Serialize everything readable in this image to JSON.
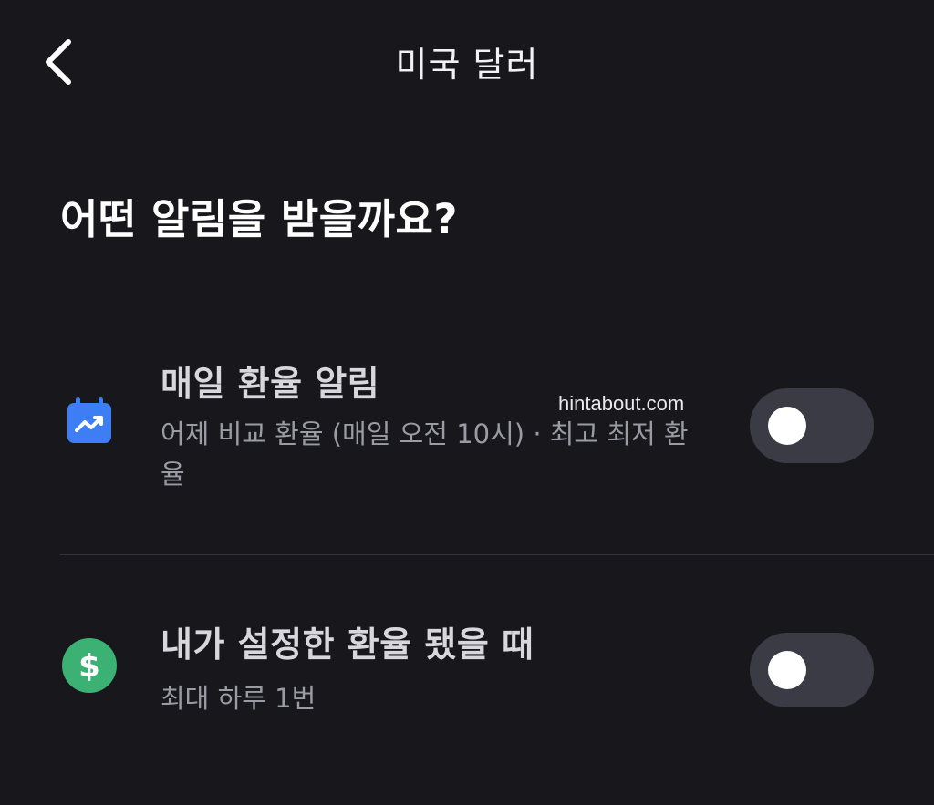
{
  "header": {
    "back_icon": "chevron-left-icon",
    "title": "미국 달러"
  },
  "heading": "어떤 알림을 받을까요?",
  "options": [
    {
      "icon": "calendar-trend-icon",
      "icon_color": "#3d7ef5",
      "title": "매일 환율 알림",
      "subtitle": "어제 비교 환율 (매일 오전 10시) · 최고 최저 환율",
      "enabled": false
    },
    {
      "icon": "dollar-circle-icon",
      "icon_color": "#3bb273",
      "icon_glyph": "$",
      "title": "내가 설정한 환율 됐을 때",
      "subtitle": "최대 하루 1번",
      "enabled": false
    }
  ],
  "watermark": "hintabout.com",
  "colors": {
    "background": "#17171c",
    "toggle_off": "#3b3b46",
    "divider": "#34343c"
  }
}
